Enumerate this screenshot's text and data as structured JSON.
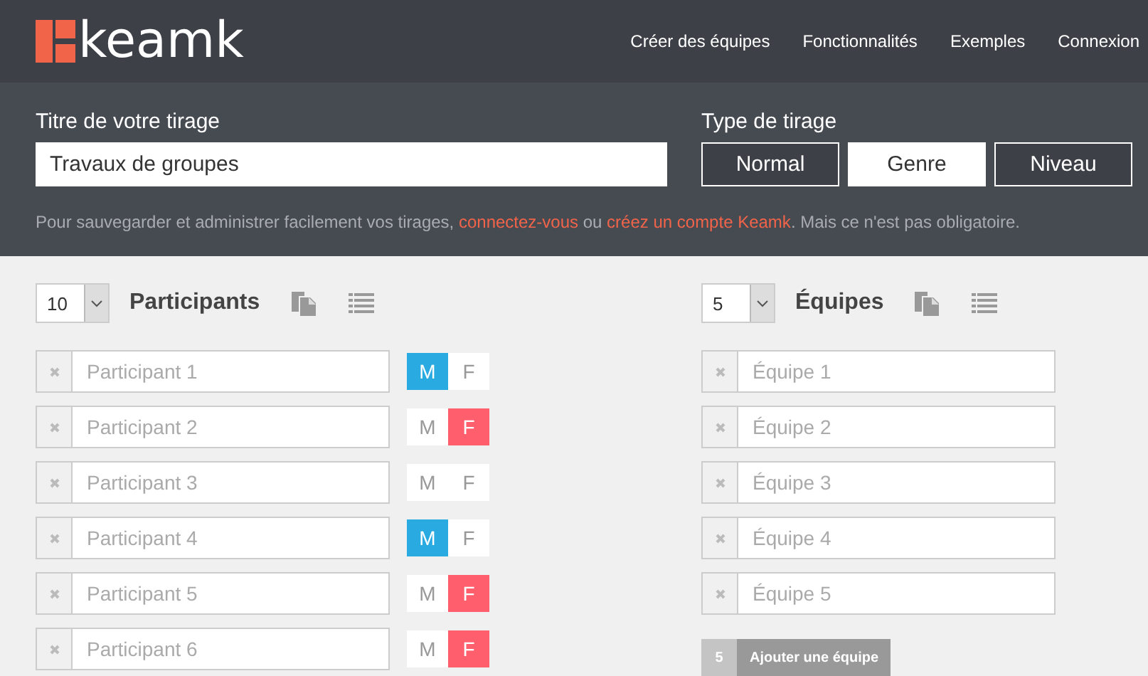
{
  "header": {
    "logo": "keamk",
    "nav": [
      "Créer des équipes",
      "Fonctionnalités",
      "Exemples",
      "Connexion"
    ]
  },
  "form": {
    "title_label": "Titre de votre tirage",
    "title_value": "Travaux de groupes",
    "type_label": "Type de tirage",
    "types": [
      {
        "label": "Normal",
        "selected": false
      },
      {
        "label": "Genre",
        "selected": true
      },
      {
        "label": "Niveau",
        "selected": false
      }
    ],
    "note": [
      {
        "kind": "text",
        "text": "Pour sauvegarder et administrer facilement vos tirages, "
      },
      {
        "kind": "link",
        "text": "connectez-vous"
      },
      {
        "kind": "text",
        "text": " ou "
      },
      {
        "kind": "link",
        "text": "créez un compte Keamk"
      },
      {
        "kind": "text",
        "text": ". Mais ce n'est pas obligatoire."
      }
    ]
  },
  "participants": {
    "count": "10",
    "title": "Participants",
    "items": [
      {
        "placeholder": "Participant 1",
        "genders": [
          {
            "label": "M",
            "selected": true
          },
          {
            "label": "F",
            "selected": false
          }
        ]
      },
      {
        "placeholder": "Participant 2",
        "genders": [
          {
            "label": "M",
            "selected": false
          },
          {
            "label": "F",
            "selected": true
          }
        ]
      },
      {
        "placeholder": "Participant 3",
        "genders": [
          {
            "label": "M",
            "selected": false
          },
          {
            "label": "F",
            "selected": false
          }
        ]
      },
      {
        "placeholder": "Participant 4",
        "genders": [
          {
            "label": "M",
            "selected": true
          },
          {
            "label": "F",
            "selected": false
          }
        ]
      },
      {
        "placeholder": "Participant 5",
        "genders": [
          {
            "label": "M",
            "selected": false
          },
          {
            "label": "F",
            "selected": true
          }
        ]
      },
      {
        "placeholder": "Participant 6",
        "genders": [
          {
            "label": "M",
            "selected": false
          },
          {
            "label": "F",
            "selected": true
          }
        ]
      }
    ]
  },
  "teams": {
    "count": "5",
    "title": "Équipes",
    "items": [
      {
        "placeholder": "Équipe 1"
      },
      {
        "placeholder": "Équipe 2"
      },
      {
        "placeholder": "Équipe 3"
      },
      {
        "placeholder": "Équipe 4"
      },
      {
        "placeholder": "Équipe 5"
      }
    ],
    "add_button": {
      "count": "5",
      "label": "Ajouter une équipe"
    }
  }
}
